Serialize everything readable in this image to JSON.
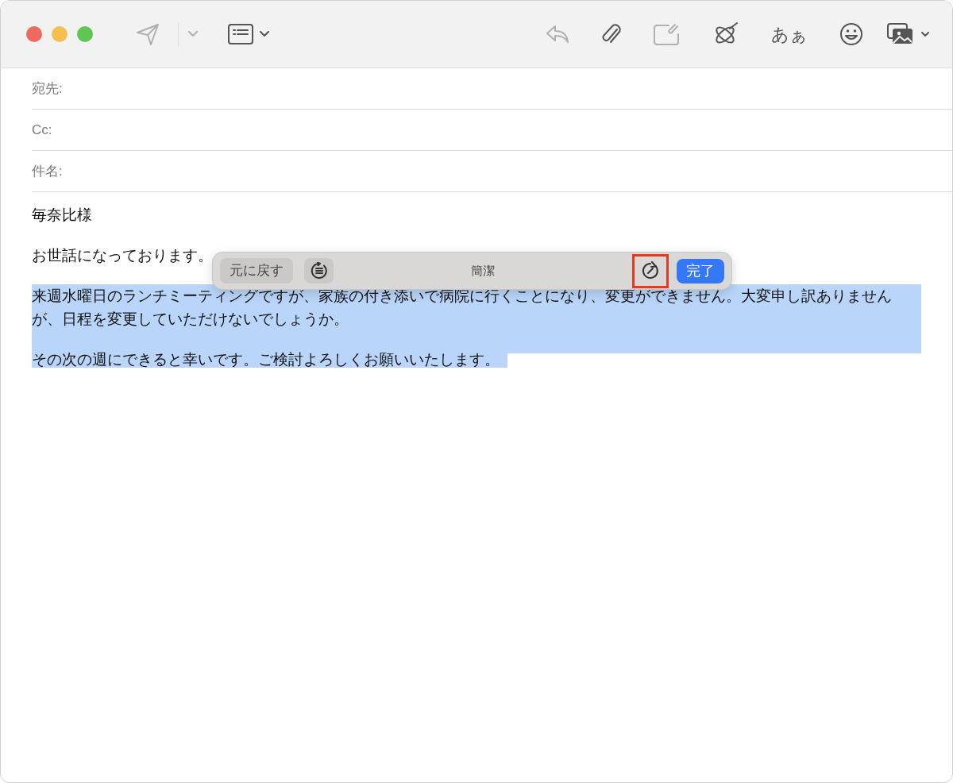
{
  "toolbar": [
    {
      "kind": "send",
      "disabled": true
    },
    {
      "kind": "caret",
      "disabled": true
    },
    {
      "kind": "header-format",
      "disabled": false
    },
    {
      "kind": "reply",
      "disabled": true
    },
    {
      "kind": "attach",
      "disabled": false
    },
    {
      "kind": "photo-attach",
      "disabled": true
    },
    {
      "kind": "writing-tools",
      "disabled": false
    },
    {
      "kind": "text",
      "label": "あぁ",
      "disabled": false
    },
    {
      "kind": "emoji",
      "disabled": false
    },
    {
      "kind": "photos",
      "disabled": false
    }
  ],
  "headers": [
    {
      "label": "宛先:"
    },
    {
      "label": "Cc:"
    },
    {
      "label": "件名:"
    }
  ],
  "body": [
    {
      "text": "毎奈比様",
      "selected": false
    },
    {
      "text": "お世話になっております。",
      "selected": false
    },
    {
      "text": "来週水曜日のランチミーティングですが、家族の付き添いで病院に行くことになり、変更ができません。大変申し訳ありませんが、日程を変更していただけないでしょうか。",
      "selected": true
    },
    {
      "text": "その次の週にできると幸いです。ご検討よろしくお願いいたします。",
      "selected": true
    }
  ],
  "rewrite_bar": {
    "undo": "元に戻す",
    "mode": "簡潔",
    "done": "完了",
    "highlighted": true
  }
}
